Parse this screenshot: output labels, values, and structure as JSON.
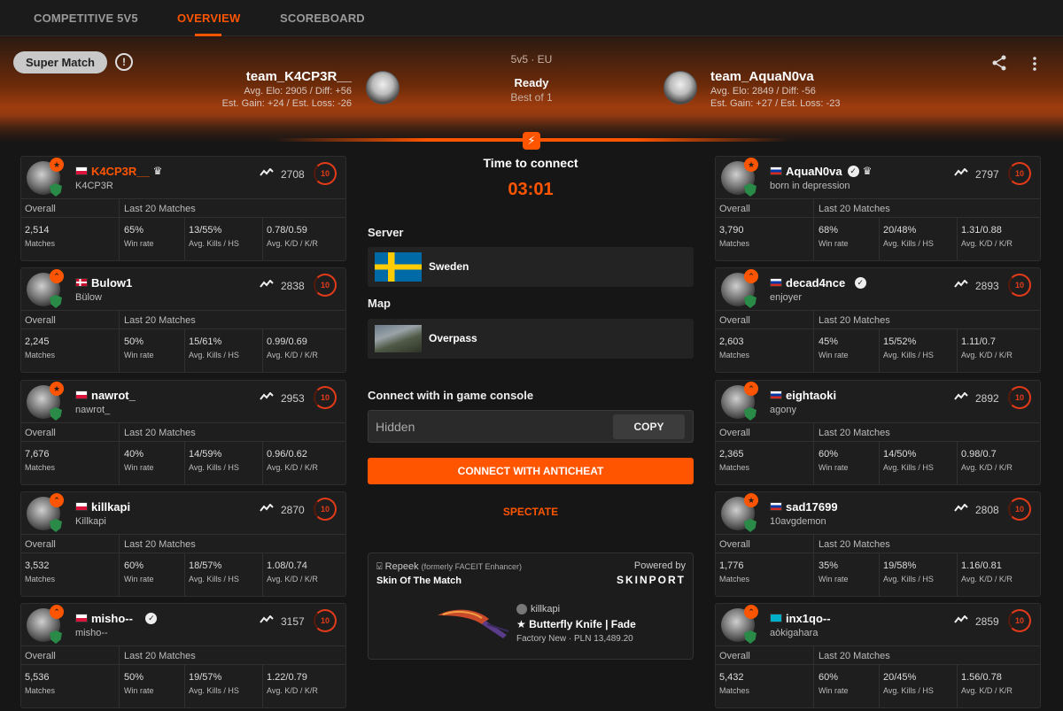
{
  "tabs": [
    {
      "label": "COMPETITIVE 5V5"
    },
    {
      "label": "OVERVIEW"
    },
    {
      "label": "SCOREBOARD"
    }
  ],
  "header": {
    "match_type": "Super Match",
    "format": "5v5 · EU",
    "status": "Ready",
    "best_of": "Best of 1",
    "team1": {
      "name": "team_K4CP3R__",
      "elo_line": "Avg. Elo: 2905 / Diff: +56",
      "gain_line": "Est. Gain: +24 / Est. Loss: -26"
    },
    "team2": {
      "name": "team_AquaN0va",
      "elo_line": "Avg. Elo: 2849 / Diff: -56",
      "gain_line": "Est. Gain: +27 / Est. Loss: -23"
    }
  },
  "center": {
    "time_to_connect": "Time to connect",
    "timer": "03:01",
    "server_label": "Server",
    "server_value": "Sweden",
    "map_label": "Map",
    "map_value": "Overpass",
    "console_label": "Connect with in game console",
    "console_placeholder": "Hidden",
    "copy_label": "COPY",
    "connect_label": "CONNECT WITH ANTICHEAT",
    "spectate_label": "SPECTATE"
  },
  "ad": {
    "brand": "Repeek",
    "brand_note": "(formerly FACEIT Enhancer)",
    "title": "Skin Of The Match",
    "powered_by": "Powered by",
    "sponsor": "SKINPORT",
    "owner": "killkapi",
    "skin": "★ Butterfly Knife | Fade",
    "price": "Factory New · PLN 13,489.20"
  },
  "labels": {
    "overall": "Overall",
    "last20": "Last 20 Matches",
    "matches": "Matches",
    "win_rate": "Win rate",
    "kills_hs": "Avg. Kills / HS",
    "kd_kr": "Avg. K/D / K/R"
  },
  "team1_players": [
    {
      "nick": "K4CP3R__",
      "sub": "K4CP3R",
      "elo": "2708",
      "level": "10",
      "matches": "2,514",
      "winrate": "65%",
      "kills_hs": "13/55%",
      "kd_kr": "0.78/0.59"
    },
    {
      "nick": "Bulow1",
      "sub": "Bülow",
      "elo": "2838",
      "level": "10",
      "matches": "2,245",
      "winrate": "50%",
      "kills_hs": "15/61%",
      "kd_kr": "0.99/0.69"
    },
    {
      "nick": "nawrot_",
      "sub": "nawrot_",
      "elo": "2953",
      "level": "10",
      "matches": "7,676",
      "winrate": "40%",
      "kills_hs": "14/59%",
      "kd_kr": "0.96/0.62"
    },
    {
      "nick": "killkapi",
      "sub": "Killkapi",
      "elo": "2870",
      "level": "10",
      "matches": "3,532",
      "winrate": "60%",
      "kills_hs": "18/57%",
      "kd_kr": "1.08/0.74"
    },
    {
      "nick": "misho--",
      "sub": "misho--",
      "elo": "3157",
      "level": "10",
      "matches": "5,536",
      "winrate": "50%",
      "kills_hs": "19/57%",
      "kd_kr": "1.22/0.79"
    }
  ],
  "team2_players": [
    {
      "nick": "AquaN0va",
      "sub": "born in depression",
      "elo": "2797",
      "level": "10",
      "matches": "3,790",
      "winrate": "68%",
      "kills_hs": "20/48%",
      "kd_kr": "1.31/0.88"
    },
    {
      "nick": "decad4nce",
      "sub": "enjoyer",
      "elo": "2893",
      "level": "10",
      "matches": "2,603",
      "winrate": "45%",
      "kills_hs": "15/52%",
      "kd_kr": "1.11/0.7"
    },
    {
      "nick": "eightaoki",
      "sub": "agony",
      "elo": "2892",
      "level": "10",
      "matches": "2,365",
      "winrate": "60%",
      "kills_hs": "14/50%",
      "kd_kr": "0.98/0.7"
    },
    {
      "nick": "sad17699",
      "sub": "10avgdemon",
      "elo": "2808",
      "level": "10",
      "matches": "1,776",
      "winrate": "35%",
      "kills_hs": "19/58%",
      "kd_kr": "1.16/0.81"
    },
    {
      "nick": "inx1qo--",
      "sub": "aòkigahara",
      "elo": "2859",
      "level": "10",
      "matches": "5,432",
      "winrate": "60%",
      "kills_hs": "20/45%",
      "kd_kr": "1.56/0.78"
    }
  ],
  "icons": {
    "info": "info-icon",
    "share": "share-icon",
    "more": "more-vertical-icon",
    "bolt": "lightning-icon",
    "trend": "trend-icon",
    "verified": "verified-icon",
    "crown": "crown-icon"
  },
  "colors": {
    "accent": "#ff5500",
    "level10": "#e33b1a",
    "anticheat": "#2a8a47"
  }
}
